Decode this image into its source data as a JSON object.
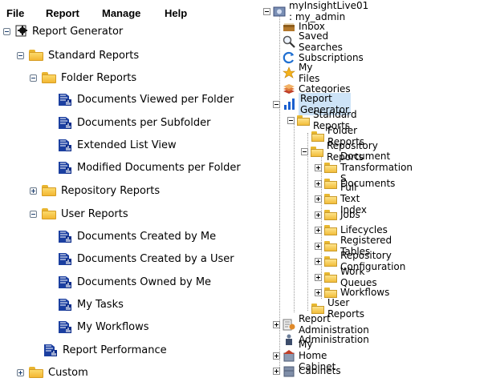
{
  "menu": {
    "file": "File",
    "report": "Report",
    "manage": "Manage",
    "help": "Help"
  },
  "left_tree": {
    "root": "Report Generator",
    "standard_reports": "Standard Reports",
    "folder_reports": "Folder Reports",
    "folder_items": [
      "Documents Viewed per Folder",
      "Documents per Subfolder",
      "Extended List View",
      "Modified Documents per Folder"
    ],
    "repository_reports": "Repository Reports",
    "user_reports": "User Reports",
    "user_items": [
      "Documents Created by Me",
      "Documents Created by a User",
      "Documents Owned by Me",
      "My Tasks",
      "My Workflows"
    ],
    "report_performance": "Report Performance",
    "custom": "Custom"
  },
  "right_tree": {
    "repo": "myInsightLive01 : my_admin",
    "inbox": "Inbox",
    "saved_searches": "Saved Searches",
    "subscriptions": "Subscriptions",
    "my_files": "My Files",
    "categories": "Categories",
    "report_generator": "Report Generator",
    "standard_reports": "Standard Reports",
    "folder_reports": "Folder Reports",
    "repository_reports": "Repository Reports",
    "repo_items": [
      "Document Transformation S",
      "Documents",
      "Full Text Index",
      "Jobs",
      "Lifecycles",
      "Registered Tables",
      "Repository Configuration",
      "Work Queues",
      "Workflows"
    ],
    "user_reports": "User Reports",
    "report_administration": "Report Administration",
    "administration": "Administration",
    "my_home_cabinet": "My Home Cabinet",
    "cabinets": "Cabinets"
  },
  "colors": {
    "selection": "#cde3f7",
    "folder": "#f3b733",
    "report_icon": "#1b3fa0"
  }
}
